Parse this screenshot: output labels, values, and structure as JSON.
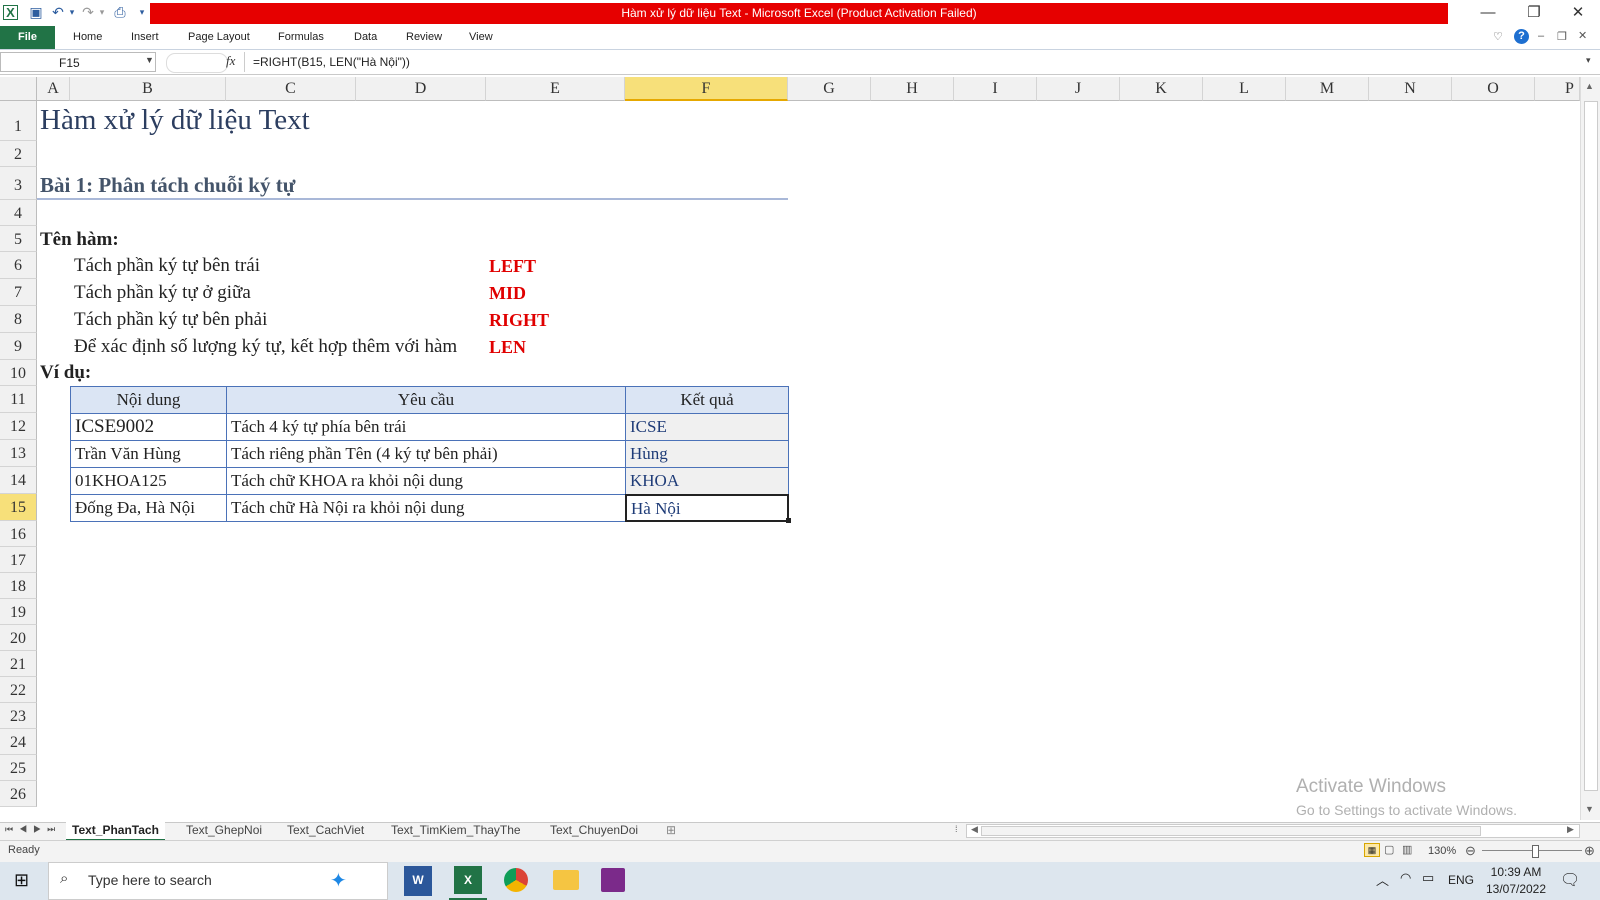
{
  "title_bar": {
    "title": "Hàm xử lý dữ liệu Text  -  Microsoft Excel (Product Activation Failed)",
    "minimize": "—",
    "restore": "❐",
    "close": "✕"
  },
  "ribbon": {
    "tabs": [
      "File",
      "Home",
      "Insert",
      "Page Layout",
      "Formulas",
      "Data",
      "Review",
      "View"
    ]
  },
  "formula_bar": {
    "name_box": "F15",
    "fx": "fx",
    "formula": "=RIGHT(B15, LEN(\"Hà Nội\"))"
  },
  "columns": [
    "A",
    "B",
    "C",
    "D",
    "E",
    "F",
    "G",
    "H",
    "I",
    "J",
    "K",
    "L",
    "M",
    "N",
    "O",
    "P"
  ],
  "rows": [
    "1",
    "2",
    "3",
    "4",
    "5",
    "6",
    "7",
    "8",
    "9",
    "10",
    "11",
    "12",
    "13",
    "14",
    "15",
    "16",
    "17",
    "18",
    "19",
    "20",
    "21",
    "22",
    "23",
    "24",
    "25",
    "26"
  ],
  "sheet": {
    "title": "Hàm xử lý dữ liệu Text",
    "section": "Bài 1: Phân tách chuỗi ký tự",
    "func_label": "Tên hàm:",
    "functions": [
      {
        "desc": "Tách phần ký tự bên trái",
        "name": "LEFT"
      },
      {
        "desc": "Tách phần ký tự ở giữa",
        "name": "MID"
      },
      {
        "desc": "Tách phần ký tự bên phải",
        "name": "RIGHT"
      },
      {
        "desc": "Để xác định số lượng ký tự, kết hợp thêm với hàm",
        "name": "LEN"
      }
    ],
    "example_label": "Ví dụ:",
    "table": {
      "headers": [
        "Nội dung",
        "Yêu cầu",
        "Kết quả"
      ],
      "rows": [
        [
          "ICSE9002",
          "Tách 4 ký tự phía bên trái",
          "ICSE"
        ],
        [
          "Trần Văn Hùng",
          "Tách riêng phần Tên (4 ký tự bên phải)",
          "Hùng"
        ],
        [
          "01KHOA125",
          "Tách chữ KHOA ra khỏi nội dung",
          "KHOA"
        ],
        [
          "Đống Đa, Hà Nội",
          "Tách chữ Hà Nội ra khỏi nội dung",
          "Hà Nội"
        ]
      ]
    }
  },
  "watermark": {
    "line1": "Activate Windows",
    "line2": "Go to Settings to activate Windows."
  },
  "sheet_tabs": [
    "Text_PhanTach",
    "Text_GhepNoi",
    "Text_CachViet",
    "Text_TimKiem_ThayThe",
    "Text_ChuyenDoi"
  ],
  "status": {
    "ready": "Ready",
    "zoom": "130%"
  },
  "taskbar": {
    "search_placeholder": "Type here to search",
    "lang": "ENG",
    "time": "10:39 AM",
    "date": "13/07/2022"
  },
  "colors": {
    "title_red": "#e60000",
    "file_tab": "#217346",
    "function_red": "#e00000",
    "table_border": "#4b72b8",
    "header_fill": "#dbe5f4",
    "selected_header": "#f7e07a"
  }
}
